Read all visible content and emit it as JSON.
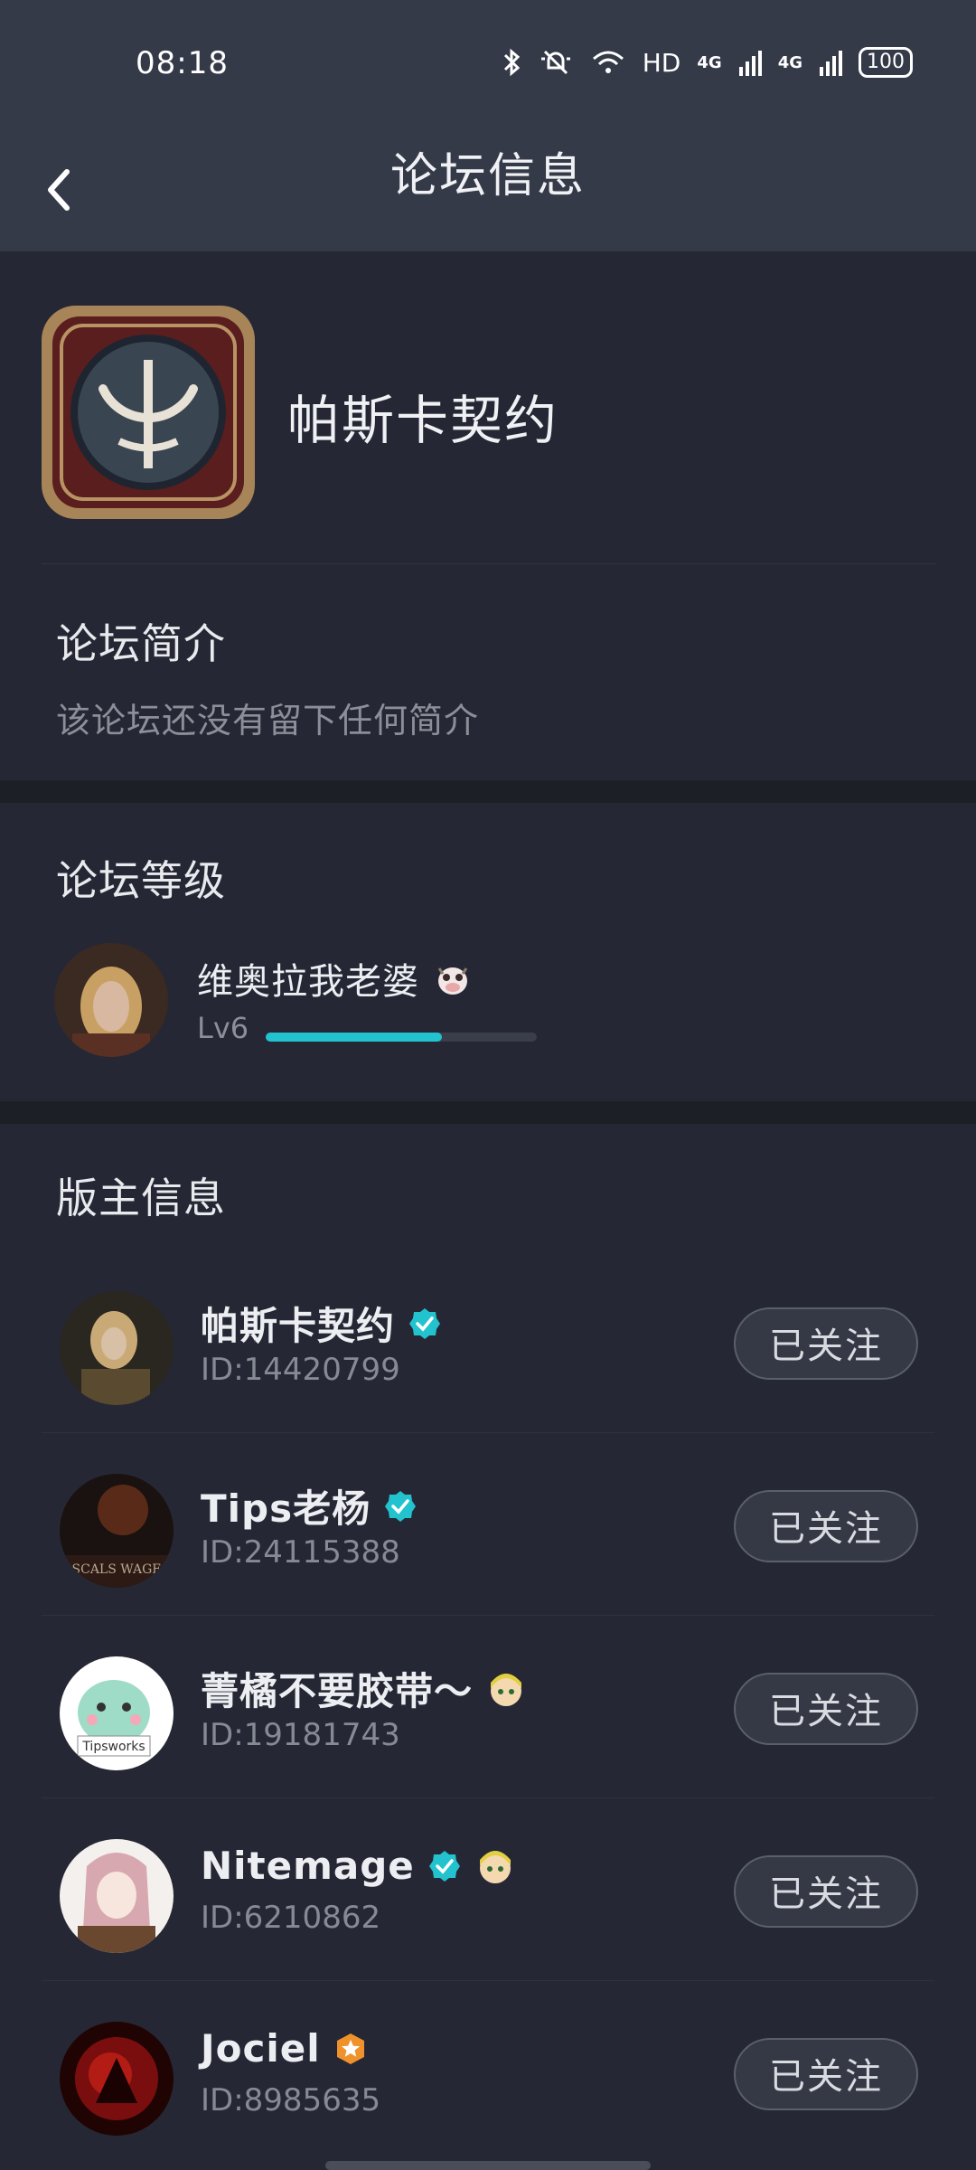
{
  "status_bar": {
    "time": "08:18",
    "hd": "HD",
    "net1": "4G",
    "net2": "4G",
    "battery": "100"
  },
  "header": {
    "back_icon": "chevron-left-icon",
    "title": "论坛信息"
  },
  "forum": {
    "name": "帕斯卡契约",
    "intro_title": "论坛简介",
    "intro_text": "该论坛还没有留下任何简介"
  },
  "level": {
    "title": "论坛等级",
    "user_name": "维奥拉我老婆",
    "level_label": "Lv6",
    "progress": 0.65
  },
  "moderators": {
    "title": "版主信息",
    "items": [
      {
        "name": "帕斯卡契约",
        "id": "ID:14420799",
        "badge": "verified-teal",
        "button": "已关注"
      },
      {
        "name": "Tips老杨",
        "id": "ID:24115388",
        "badge": "verified-teal",
        "button": "已关注"
      },
      {
        "name": "菁橘不要胶带～",
        "id": "ID:19181743",
        "badge": "emoji",
        "button": "已关注"
      },
      {
        "name": "Nitemage",
        "id": "ID:6210862",
        "badge": "verified-teal",
        "button": "已关注"
      },
      {
        "name": "Jociel",
        "id": "ID:8985635",
        "badge": "star-orange",
        "button": "已关注"
      }
    ]
  },
  "colors": {
    "accent": "#22c3cf",
    "background": "#252834",
    "header": "#343a48",
    "badge_orange": "#f0922b"
  }
}
